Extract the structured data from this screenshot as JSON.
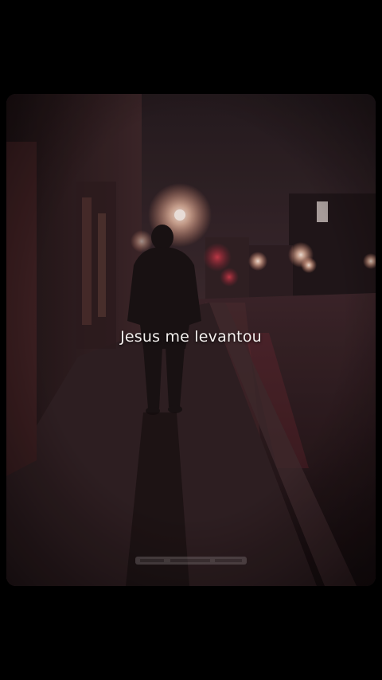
{
  "caption": {
    "text": "Jesus me levantou"
  },
  "scene": {
    "description_icon": "night-street-photo-icon",
    "colors": {
      "page_background": "#000000",
      "sky": "#2a2024",
      "street_light": "#ffd9c2",
      "red_glow": "#c0303a",
      "caption_text": "#f4f0ee"
    }
  }
}
